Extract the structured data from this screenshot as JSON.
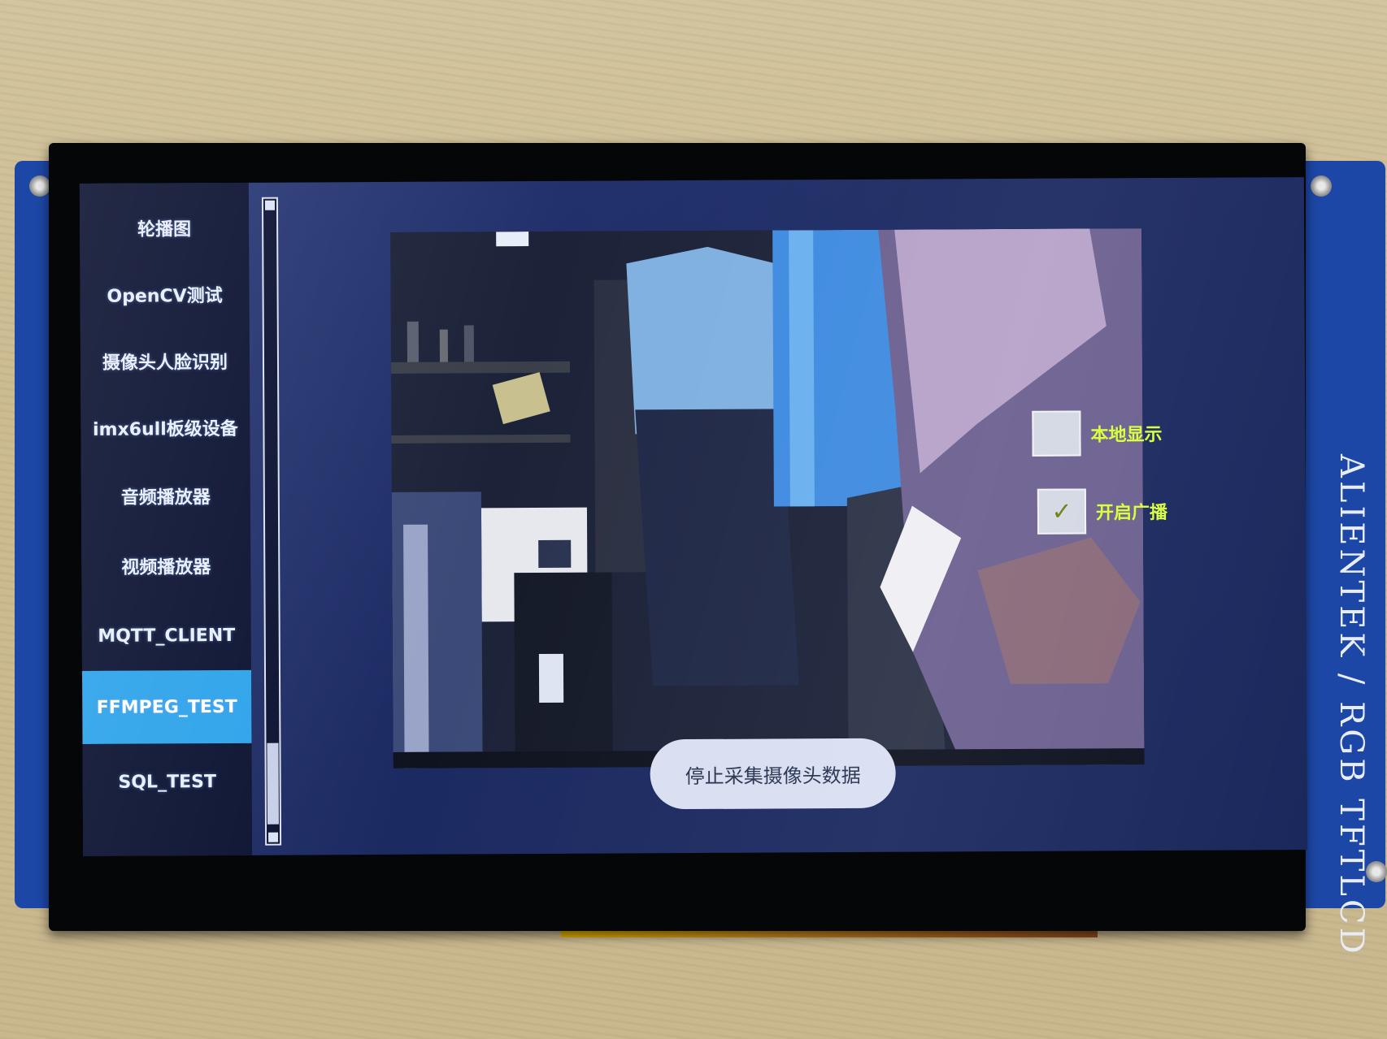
{
  "device": {
    "pcb_silkscreen": "ALIENTEK / RGB TFTLCD",
    "colors": {
      "pcb": "#1c47a6",
      "bezel": "#050608",
      "accent": "#2da3ea",
      "checkbox_label": "#d8ff3a"
    }
  },
  "menu": {
    "items": [
      {
        "label": "轮播图",
        "active": false
      },
      {
        "label": "OpenCV测试",
        "active": false
      },
      {
        "label": "摄像头人脸识别",
        "active": false
      },
      {
        "label": "imx6ull板级设备",
        "active": false
      },
      {
        "label": "音频播放器",
        "active": false
      },
      {
        "label": "视频播放器",
        "active": false
      },
      {
        "label": "MQTT_CLIENT",
        "active": false
      },
      {
        "label": "FFMPEG_TEST",
        "active": true
      },
      {
        "label": "SQL_TEST",
        "active": false
      }
    ],
    "scroll_position": 0.85
  },
  "camera_view": {
    "icon": "camera-feed"
  },
  "options": {
    "local_display": {
      "label": "本地显示",
      "checked": false
    },
    "enable_broadcast": {
      "label": "开启广播",
      "checked": true
    }
  },
  "stop_button": {
    "label": "停止采集摄像头数据"
  }
}
